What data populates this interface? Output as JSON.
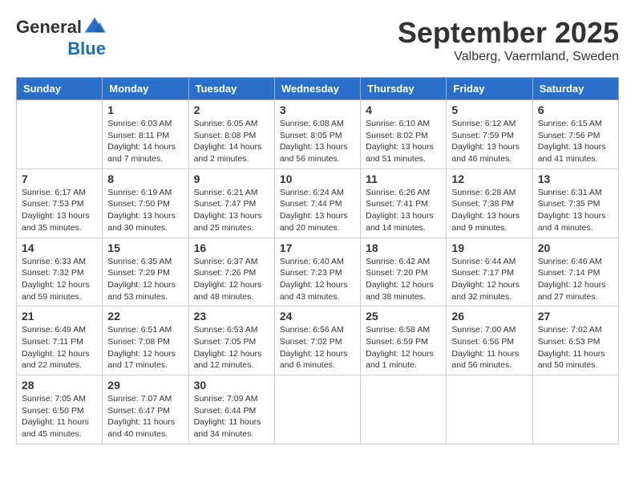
{
  "header": {
    "logo_general": "General",
    "logo_blue": "Blue",
    "month": "September 2025",
    "location": "Valberg, Vaermland, Sweden"
  },
  "columns": [
    "Sunday",
    "Monday",
    "Tuesday",
    "Wednesday",
    "Thursday",
    "Friday",
    "Saturday"
  ],
  "weeks": [
    [
      {
        "day": "",
        "empty": true
      },
      {
        "day": "1",
        "sunrise": "Sunrise: 6:03 AM",
        "sunset": "Sunset: 8:11 PM",
        "daylight": "Daylight: 14 hours and 7 minutes."
      },
      {
        "day": "2",
        "sunrise": "Sunrise: 6:05 AM",
        "sunset": "Sunset: 8:08 PM",
        "daylight": "Daylight: 14 hours and 2 minutes."
      },
      {
        "day": "3",
        "sunrise": "Sunrise: 6:08 AM",
        "sunset": "Sunset: 8:05 PM",
        "daylight": "Daylight: 13 hours and 56 minutes."
      },
      {
        "day": "4",
        "sunrise": "Sunrise: 6:10 AM",
        "sunset": "Sunset: 8:02 PM",
        "daylight": "Daylight: 13 hours and 51 minutes."
      },
      {
        "day": "5",
        "sunrise": "Sunrise: 6:12 AM",
        "sunset": "Sunset: 7:59 PM",
        "daylight": "Daylight: 13 hours and 46 minutes."
      },
      {
        "day": "6",
        "sunrise": "Sunrise: 6:15 AM",
        "sunset": "Sunset: 7:56 PM",
        "daylight": "Daylight: 13 hours and 41 minutes."
      }
    ],
    [
      {
        "day": "7",
        "sunrise": "Sunrise: 6:17 AM",
        "sunset": "Sunset: 7:53 PM",
        "daylight": "Daylight: 13 hours and 35 minutes."
      },
      {
        "day": "8",
        "sunrise": "Sunrise: 6:19 AM",
        "sunset": "Sunset: 7:50 PM",
        "daylight": "Daylight: 13 hours and 30 minutes."
      },
      {
        "day": "9",
        "sunrise": "Sunrise: 6:21 AM",
        "sunset": "Sunset: 7:47 PM",
        "daylight": "Daylight: 13 hours and 25 minutes."
      },
      {
        "day": "10",
        "sunrise": "Sunrise: 6:24 AM",
        "sunset": "Sunset: 7:44 PM",
        "daylight": "Daylight: 13 hours and 20 minutes."
      },
      {
        "day": "11",
        "sunrise": "Sunrise: 6:26 AM",
        "sunset": "Sunset: 7:41 PM",
        "daylight": "Daylight: 13 hours and 14 minutes."
      },
      {
        "day": "12",
        "sunrise": "Sunrise: 6:28 AM",
        "sunset": "Sunset: 7:38 PM",
        "daylight": "Daylight: 13 hours and 9 minutes."
      },
      {
        "day": "13",
        "sunrise": "Sunrise: 6:31 AM",
        "sunset": "Sunset: 7:35 PM",
        "daylight": "Daylight: 13 hours and 4 minutes."
      }
    ],
    [
      {
        "day": "14",
        "sunrise": "Sunrise: 6:33 AM",
        "sunset": "Sunset: 7:32 PM",
        "daylight": "Daylight: 12 hours and 59 minutes."
      },
      {
        "day": "15",
        "sunrise": "Sunrise: 6:35 AM",
        "sunset": "Sunset: 7:29 PM",
        "daylight": "Daylight: 12 hours and 53 minutes."
      },
      {
        "day": "16",
        "sunrise": "Sunrise: 6:37 AM",
        "sunset": "Sunset: 7:26 PM",
        "daylight": "Daylight: 12 hours and 48 minutes."
      },
      {
        "day": "17",
        "sunrise": "Sunrise: 6:40 AM",
        "sunset": "Sunset: 7:23 PM",
        "daylight": "Daylight: 12 hours and 43 minutes."
      },
      {
        "day": "18",
        "sunrise": "Sunrise: 6:42 AM",
        "sunset": "Sunset: 7:20 PM",
        "daylight": "Daylight: 12 hours and 38 minutes."
      },
      {
        "day": "19",
        "sunrise": "Sunrise: 6:44 AM",
        "sunset": "Sunset: 7:17 PM",
        "daylight": "Daylight: 12 hours and 32 minutes."
      },
      {
        "day": "20",
        "sunrise": "Sunrise: 6:46 AM",
        "sunset": "Sunset: 7:14 PM",
        "daylight": "Daylight: 12 hours and 27 minutes."
      }
    ],
    [
      {
        "day": "21",
        "sunrise": "Sunrise: 6:49 AM",
        "sunset": "Sunset: 7:11 PM",
        "daylight": "Daylight: 12 hours and 22 minutes."
      },
      {
        "day": "22",
        "sunrise": "Sunrise: 6:51 AM",
        "sunset": "Sunset: 7:08 PM",
        "daylight": "Daylight: 12 hours and 17 minutes."
      },
      {
        "day": "23",
        "sunrise": "Sunrise: 6:53 AM",
        "sunset": "Sunset: 7:05 PM",
        "daylight": "Daylight: 12 hours and 12 minutes."
      },
      {
        "day": "24",
        "sunrise": "Sunrise: 6:56 AM",
        "sunset": "Sunset: 7:02 PM",
        "daylight": "Daylight: 12 hours and 6 minutes."
      },
      {
        "day": "25",
        "sunrise": "Sunrise: 6:58 AM",
        "sunset": "Sunset: 6:59 PM",
        "daylight": "Daylight: 12 hours and 1 minute."
      },
      {
        "day": "26",
        "sunrise": "Sunrise: 7:00 AM",
        "sunset": "Sunset: 6:56 PM",
        "daylight": "Daylight: 11 hours and 56 minutes."
      },
      {
        "day": "27",
        "sunrise": "Sunrise: 7:02 AM",
        "sunset": "Sunset: 6:53 PM",
        "daylight": "Daylight: 11 hours and 50 minutes."
      }
    ],
    [
      {
        "day": "28",
        "sunrise": "Sunrise: 7:05 AM",
        "sunset": "Sunset: 6:50 PM",
        "daylight": "Daylight: 11 hours and 45 minutes."
      },
      {
        "day": "29",
        "sunrise": "Sunrise: 7:07 AM",
        "sunset": "Sunset: 6:47 PM",
        "daylight": "Daylight: 11 hours and 40 minutes."
      },
      {
        "day": "30",
        "sunrise": "Sunrise: 7:09 AM",
        "sunset": "Sunset: 6:44 PM",
        "daylight": "Daylight: 11 hours and 34 minutes."
      },
      {
        "day": "",
        "empty": true
      },
      {
        "day": "",
        "empty": true
      },
      {
        "day": "",
        "empty": true
      },
      {
        "day": "",
        "empty": true
      }
    ]
  ]
}
